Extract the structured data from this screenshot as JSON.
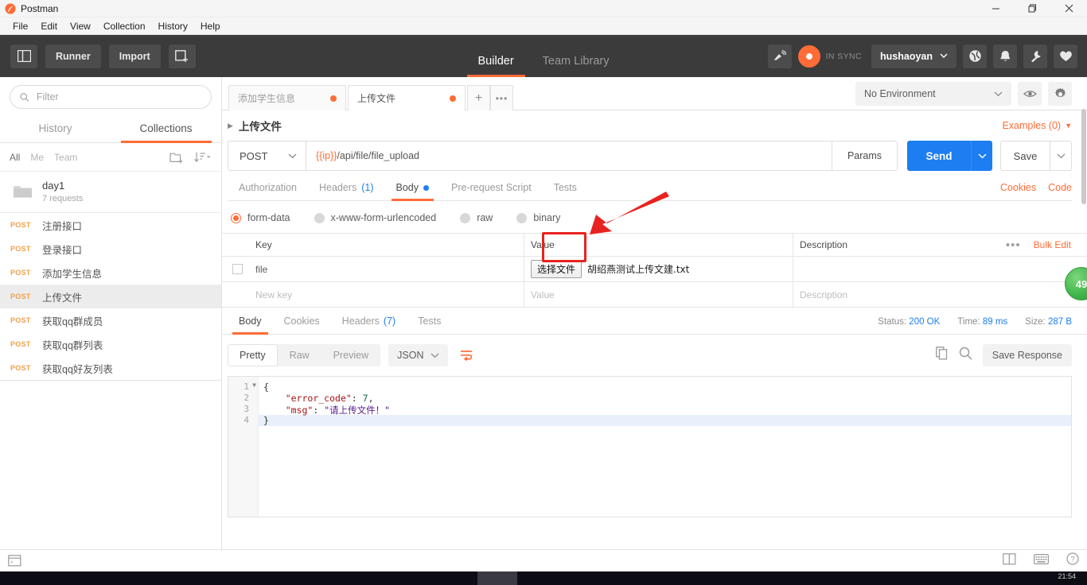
{
  "window": {
    "title": "Postman",
    "controls": {
      "minimize": "minimize-icon",
      "maximize": "maximize-icon",
      "close": "close-icon"
    }
  },
  "menubar": {
    "items": [
      "File",
      "Edit",
      "View",
      "Collection",
      "History",
      "Help"
    ]
  },
  "header": {
    "sidebar_toggle": "sidebar-toggle-icon",
    "runner": "Runner",
    "import": "Import",
    "new_tab": "new-window-icon",
    "tabs": [
      {
        "label": "Builder",
        "active": true
      },
      {
        "label": "Team Library",
        "active": false
      }
    ],
    "broadcast_icon": "broadcast-icon",
    "sync_status": "IN SYNC",
    "user": "hushaoyan",
    "icons": [
      "globe-icon",
      "bell-icon",
      "wrench-icon",
      "heart-icon"
    ]
  },
  "sidebar": {
    "filter_placeholder": "Filter",
    "search_icon": "search-icon",
    "tabs": [
      {
        "label": "History",
        "active": false
      },
      {
        "label": "Collections",
        "active": true
      }
    ],
    "scopes": [
      {
        "label": "All",
        "active": true
      },
      {
        "label": "Me",
        "active": false
      },
      {
        "label": "Team",
        "active": false
      }
    ],
    "new_folder_icon": "new-folder-icon",
    "sort_icon": "sort-descending-icon",
    "collection": {
      "name": "day1",
      "subtitle": "7 requests",
      "folder_icon": "folder-icon"
    },
    "requests": [
      {
        "method": "POST",
        "name": "注册接口",
        "selected": false
      },
      {
        "method": "POST",
        "name": "登录接口",
        "selected": false
      },
      {
        "method": "POST",
        "name": "添加学生信息",
        "selected": false
      },
      {
        "method": "POST",
        "name": "上传文件",
        "selected": true
      },
      {
        "method": "POST",
        "name": "获取qq群成员",
        "selected": false
      },
      {
        "method": "POST",
        "name": "获取qq群列表",
        "selected": false
      },
      {
        "method": "POST",
        "name": "获取qq好友列表",
        "selected": false
      }
    ]
  },
  "environment": {
    "selected": "No Environment",
    "eye_icon": "eye-icon",
    "gear_icon": "gear-icon",
    "chevron_icon": "chevron-down-icon"
  },
  "request_tabs": {
    "tabs": [
      {
        "label": "添加学生信息",
        "unsaved": true,
        "active": false
      },
      {
        "label": "上传文件",
        "unsaved": true,
        "active": true
      }
    ],
    "add_label": "+",
    "more_label": "•••"
  },
  "request": {
    "breadcrumb": "上传文件",
    "breadcrumb_caret": "chevron-right-icon",
    "examples": "Examples (0)",
    "examples_caret": "caret-down-icon",
    "method": "POST",
    "method_caret": "chevron-down-icon",
    "url_variable": "{{ip}}",
    "url_rest": "/api/file/file_upload",
    "params_label": "Params",
    "send_label": "Send",
    "send_caret": "chevron-down-icon",
    "save_label": "Save",
    "save_caret": "chevron-down-icon",
    "tabs": [
      {
        "label": "Authorization",
        "active": false
      },
      {
        "label": "Headers",
        "count": "(1)",
        "active": false
      },
      {
        "label": "Body",
        "dot": true,
        "active": true
      },
      {
        "label": "Pre-request Script",
        "active": false
      },
      {
        "label": "Tests",
        "active": false
      }
    ],
    "cookies_link": "Cookies",
    "code_link": "Code",
    "body_types": [
      {
        "label": "form-data",
        "selected": true
      },
      {
        "label": "x-www-form-urlencoded",
        "selected": false
      },
      {
        "label": "raw",
        "selected": false
      },
      {
        "label": "binary",
        "selected": false
      }
    ],
    "table": {
      "headers": [
        "Key",
        "Value",
        "Description"
      ],
      "more_icon": "more-options-icon",
      "bulk_edit": "Bulk Edit",
      "rows": [
        {
          "checked": false,
          "key": "file",
          "file_button": "选择文件",
          "file_name": "胡绍燕测试上传文建.txt",
          "description": ""
        }
      ],
      "placeholder_row": {
        "key": "New key",
        "value": "Value",
        "description": "Description"
      }
    }
  },
  "response": {
    "tabs": [
      {
        "label": "Body",
        "active": true
      },
      {
        "label": "Cookies",
        "active": false
      },
      {
        "label": "Headers",
        "count": "(7)",
        "active": false
      },
      {
        "label": "Tests",
        "active": false
      }
    ],
    "status_label": "Status:",
    "status_value": "200 OK",
    "time_label": "Time:",
    "time_value": "89 ms",
    "size_label": "Size:",
    "size_value": "287 B",
    "view_modes": [
      {
        "label": "Pretty",
        "active": true
      },
      {
        "label": "Raw",
        "active": false
      },
      {
        "label": "Preview",
        "active": false
      }
    ],
    "format": "JSON",
    "format_caret": "chevron-down-icon",
    "wrap_icon": "word-wrap-icon",
    "copy_icon": "copy-icon",
    "search_icon": "search-icon",
    "save_response": "Save Response",
    "code": {
      "line_numbers": [
        "1",
        "2",
        "3",
        "4"
      ],
      "lines": [
        {
          "text": "{",
          "type": "punc"
        },
        {
          "key": "\"error_code\"",
          "sep": ": ",
          "value": "7",
          "value_type": "num",
          "tail": ","
        },
        {
          "key": "\"msg\"",
          "sep": ": ",
          "value": "\"请上传文件！\"",
          "value_type": "str",
          "tail": ""
        },
        {
          "text": "}",
          "type": "punc",
          "highlight": true
        }
      ]
    }
  },
  "annotation": {
    "box_color": "#e8231f",
    "arrow_color": "#e8231f",
    "target": "{{ip}}"
  },
  "badge": {
    "text": "49",
    "color": "#3fb44a"
  },
  "footer": {
    "left_icon": "console-icon",
    "right_icons": [
      "two-pane-layout-icon",
      "keyboard-icon",
      "help-icon"
    ]
  },
  "taskbar": {
    "clock": "21:54"
  }
}
